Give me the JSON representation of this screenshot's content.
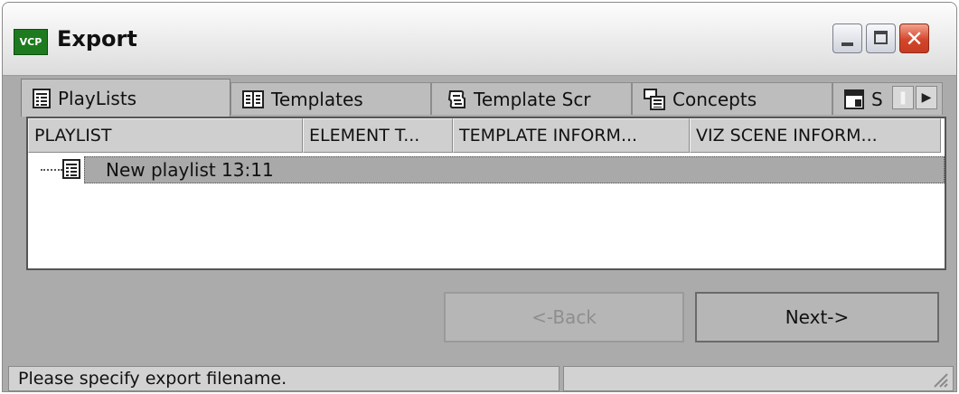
{
  "window": {
    "title": "Export",
    "app_badge": "VCP"
  },
  "tabs": [
    {
      "label": "PlayLists",
      "icon": "playlist-icon"
    },
    {
      "label": "Templates",
      "icon": "templates-icon"
    },
    {
      "label": "Template Scr",
      "icon": "script-icon"
    },
    {
      "label": "Concepts",
      "icon": "concepts-icon"
    },
    {
      "label": "S",
      "icon": "save-icon"
    }
  ],
  "table": {
    "columns": [
      "PLAYLIST",
      "ELEMENT T...",
      "TEMPLATE INFORM...",
      "VIZ SCENE INFORM..."
    ],
    "rows": [
      {
        "label": "New playlist 13:11",
        "icon": "playlist-icon",
        "selected": true
      }
    ]
  },
  "buttons": {
    "back": "<-Back",
    "next": "Next->",
    "back_enabled": false
  },
  "status": {
    "message": "Please specify export filename."
  }
}
